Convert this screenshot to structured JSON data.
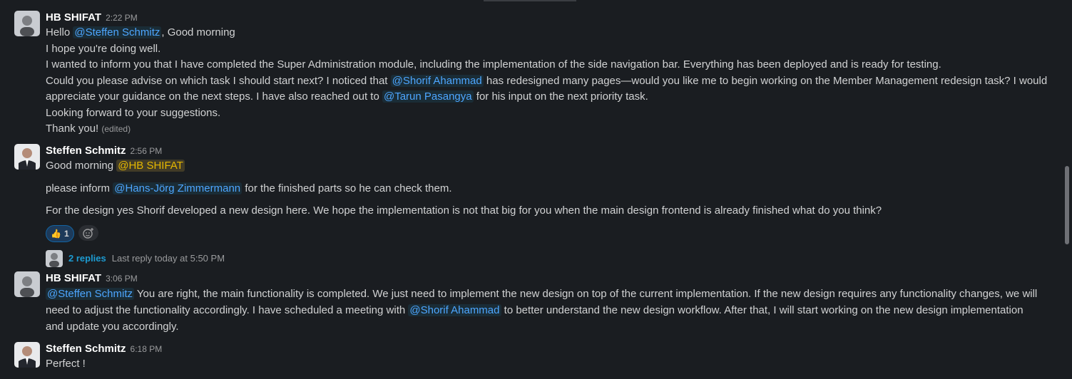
{
  "messages": [
    {
      "author": "HB SHIFAT",
      "time": "2:22 PM",
      "lines": {
        "l1": {
          "prefix": "Hello ",
          "mention": "@Steffen Schmitz",
          "suffix": ", Good morning"
        },
        "l2": "I hope you're doing well.",
        "l3": "I wanted to inform you that I have completed the Super Administration module, including the implementation of the side navigation bar. Everything has been deployed and is ready for testing.",
        "l4": {
          "prefix": "Could you please advise on which task I should start next? I noticed that ",
          "mention": "@Shorif Ahammad",
          "suffix": " has redesigned many pages—would you like me to begin working on the Member Management redesign task? I would"
        },
        "l5": {
          "prefix": "appreciate your guidance on the next steps. I have also reached out to ",
          "mention": "@Tarun Pasangya",
          "suffix": " for his input on the next priority task."
        },
        "l6": "Looking forward to your suggestions.",
        "l7": "Thank you!",
        "edited": "(edited)"
      }
    },
    {
      "author": "Steffen Schmitz",
      "time": "2:56 PM",
      "lines": {
        "l1": {
          "prefix": "Good morning ",
          "mention": "@HB SHIFAT"
        },
        "l2": {
          "prefix": "please inform ",
          "mention": "@Hans-Jörg Zimmermann",
          "suffix": " for the finished parts so he can check them."
        },
        "l3": "For the design yes Shorif developed a new design here. We hope the implementation is not that big for you when the main design frontend is already finished what do you think?"
      },
      "reaction": {
        "emoji": "👍",
        "count": "1"
      },
      "thread": {
        "replies": "2 replies",
        "last": "Last reply today at 5:50 PM"
      }
    },
    {
      "author": "HB SHIFAT",
      "time": "3:06 PM",
      "text": {
        "m1": "@Steffen Schmitz",
        "t1": " You are right, the main functionality is completed. We just need to implement the new design on top of the current implementation. If the new design requires any functionality changes, we will need to adjust the functionality accordingly. I have scheduled a meeting with ",
        "m2": "@Shorif Ahammad",
        "t2": " to better understand the new design workflow. After that, I will start working on the new design implementation and update you accordingly."
      }
    },
    {
      "author": "Steffen Schmitz",
      "time": "6:18 PM",
      "text": "Perfect !"
    }
  ]
}
